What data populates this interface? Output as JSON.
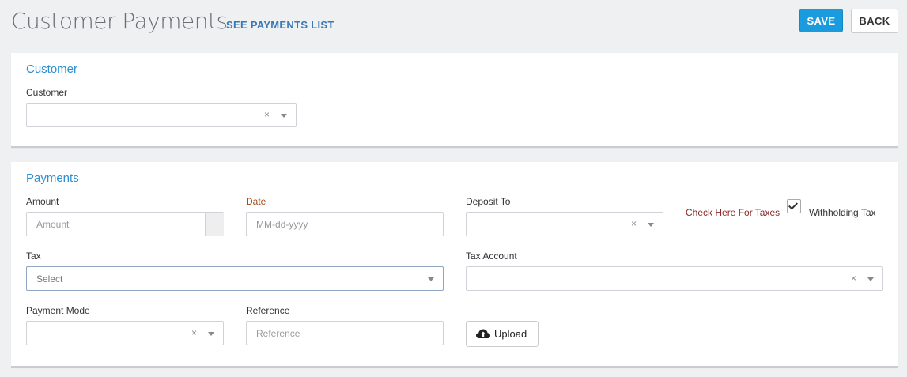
{
  "header": {
    "title": "Customer Payments",
    "see_list": "SEE PAYMENTS LIST",
    "save_label": "SAVE",
    "back_label": "BACK"
  },
  "customer_section": {
    "title": "Customer",
    "customer_label": "Customer",
    "customer_value": "",
    "clear_glyph": "×"
  },
  "payments_section": {
    "title": "Payments",
    "amount_label": "Amount",
    "amount_placeholder": "Amount",
    "date_label": "Date",
    "date_placeholder": "MM-dd-yyyy",
    "deposit_label": "Deposit To",
    "deposit_value": "",
    "tax_check_label": "Check Here For Taxes",
    "tax_checked": true,
    "withholding_label": "Withholding Tax",
    "tax_label": "Tax",
    "tax_placeholder": "Select",
    "tax_account_label": "Tax Account",
    "tax_account_value": "",
    "payment_mode_label": "Payment Mode",
    "payment_mode_value": "",
    "reference_label": "Reference",
    "reference_placeholder": "Reference",
    "upload_label": "Upload",
    "clear_glyph": "×"
  },
  "icons": {
    "clear": "close-icon",
    "dropdown": "chevron-down-icon",
    "check": "check-icon",
    "upload": "cloud-upload-icon"
  },
  "colors": {
    "accent": "#1a9bdd",
    "section_title": "#2c8fd2",
    "link": "#3b78b4",
    "date_label": "#a24b1c",
    "tax_check_label": "#8a2a2a",
    "background": "#eef0f2"
  }
}
